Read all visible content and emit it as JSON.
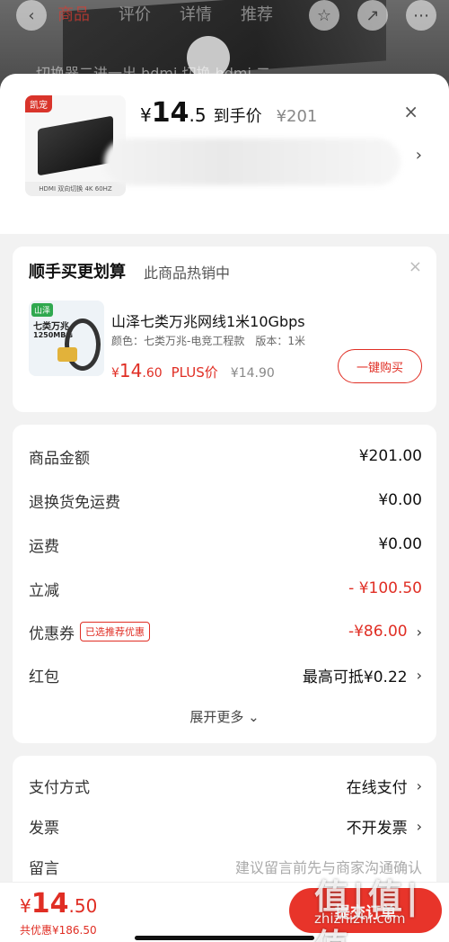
{
  "background": {
    "tabs": [
      "商品",
      "评价",
      "详情",
      "推荐"
    ],
    "search_text": "切换器二进一出 hdmi 切换 hdmi 二"
  },
  "header": {
    "thumb_brand": "凯宠",
    "thumb_caption": "HDMI 双向切换 4K 60HZ",
    "price_symbol": "¥",
    "price_int": "14",
    "price_dec": ".5",
    "price_label": "到手价",
    "original_price": "¥201",
    "close": "×",
    "chevron": "›"
  },
  "recommend": {
    "title": "顺手买更划算",
    "subtitle": "此商品热销中",
    "close": "×",
    "img_tag": "山泽",
    "img_line1": "七类万兆",
    "img_line2": "1250MB/s",
    "name": "山泽七类万兆网线1米10Gbps",
    "spec": "颜色：七类万兆-电竞工程款　版本：1米",
    "price_symbol": "¥",
    "price_int": "14",
    "price_dec": ".60",
    "plus_label": "PLUS价",
    "orig_price": "¥14.90",
    "buy_label": "一键购买"
  },
  "summary": {
    "rows": [
      {
        "label": "商品金额",
        "value": "¥201.00"
      },
      {
        "label": "退换货免运费",
        "value": "¥0.00"
      },
      {
        "label": "运费",
        "value": "¥0.00"
      },
      {
        "label": "立减",
        "value": "- ¥100.50"
      },
      {
        "label": "优惠券",
        "badge": "已选推荐优惠",
        "value": "-¥86.00"
      },
      {
        "label": "红包",
        "value": "最高可抵¥0.22"
      }
    ],
    "more_label": "展开更多 ⌄"
  },
  "payment": {
    "method_label": "支付方式",
    "method_value": "在线支付",
    "invoice_label": "发票",
    "invoice_value": "不开发票",
    "note_label": "留言",
    "note_placeholder": "建议留言前先与商家沟通确认"
  },
  "bottom": {
    "total_symbol": "¥",
    "total_int": "14",
    "total_dec": ".50",
    "saving": "共优惠¥186.50",
    "submit_label": "提交订单",
    "watermark": "值|值|值",
    "watermark_url": "zhizhizhi.com"
  },
  "colors": {
    "accent": "#e02e24",
    "button": "#e8342a",
    "sheet_bg": "#f2f2f2"
  }
}
